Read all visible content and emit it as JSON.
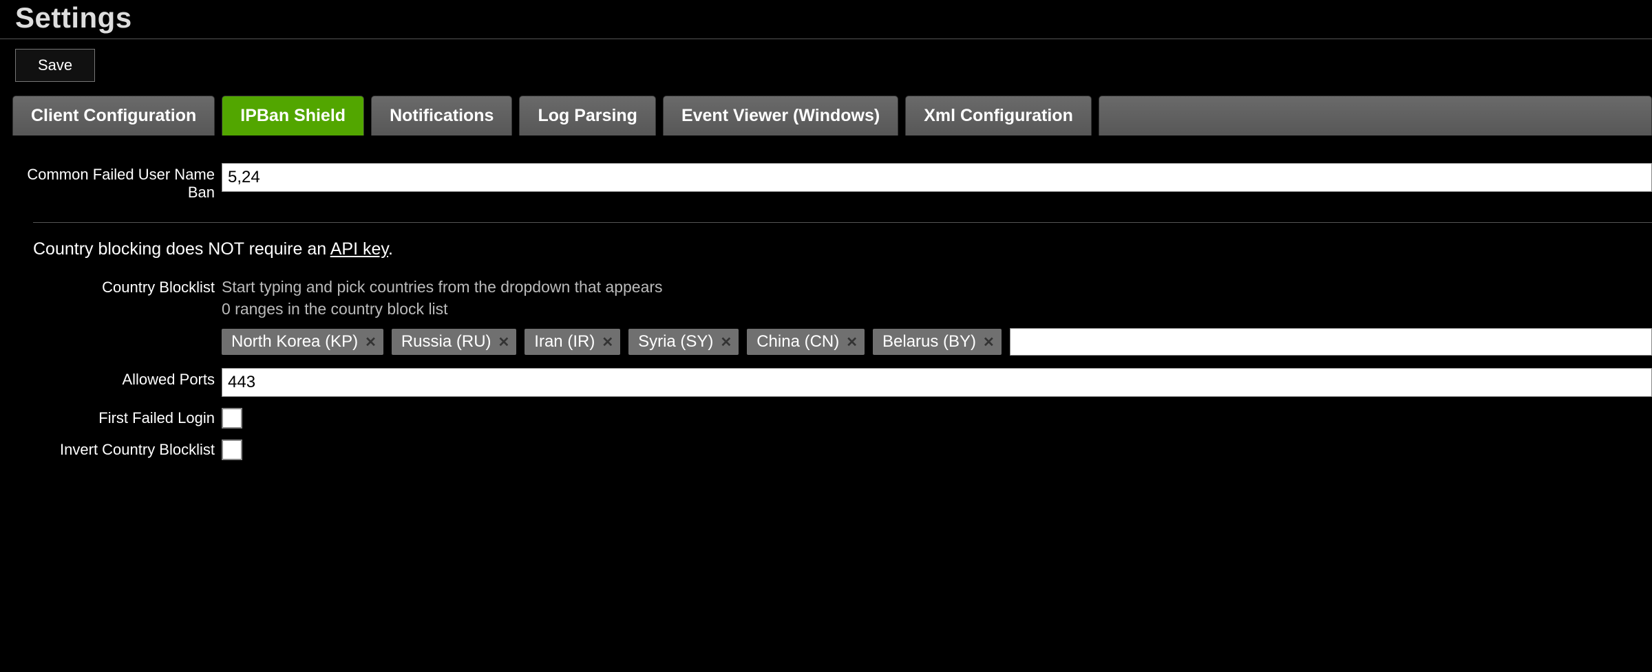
{
  "page": {
    "title": "Settings"
  },
  "toolbar": {
    "save_label": "Save"
  },
  "tabs": {
    "client_config": "Client Configuration",
    "ipban_shield": "IPBan Shield",
    "notifications": "Notifications",
    "log_parsing": "Log Parsing",
    "event_viewer": "Event Viewer (Windows)",
    "xml_config": "Xml Configuration"
  },
  "fields": {
    "common_failed_user_name_ban": {
      "label": "Common Failed User Name Ban",
      "value": "5,24"
    },
    "country_info_text": "Country blocking does NOT require an ",
    "country_info_link": "API key",
    "country_info_suffix": ".",
    "country_blocklist": {
      "label": "Country Blocklist",
      "hint1": "Start typing and pick countries from the dropdown that appears",
      "hint2": "0 ranges in the country block list",
      "tags": [
        "North Korea (KP)",
        "Russia (RU)",
        "Iran (IR)",
        "Syria (SY)",
        "China (CN)",
        "Belarus (BY)"
      ]
    },
    "allowed_ports": {
      "label": "Allowed Ports",
      "value": "443"
    },
    "first_failed_login": {
      "label": "First Failed Login"
    },
    "invert_country_blocklist": {
      "label": "Invert Country Blocklist"
    }
  }
}
